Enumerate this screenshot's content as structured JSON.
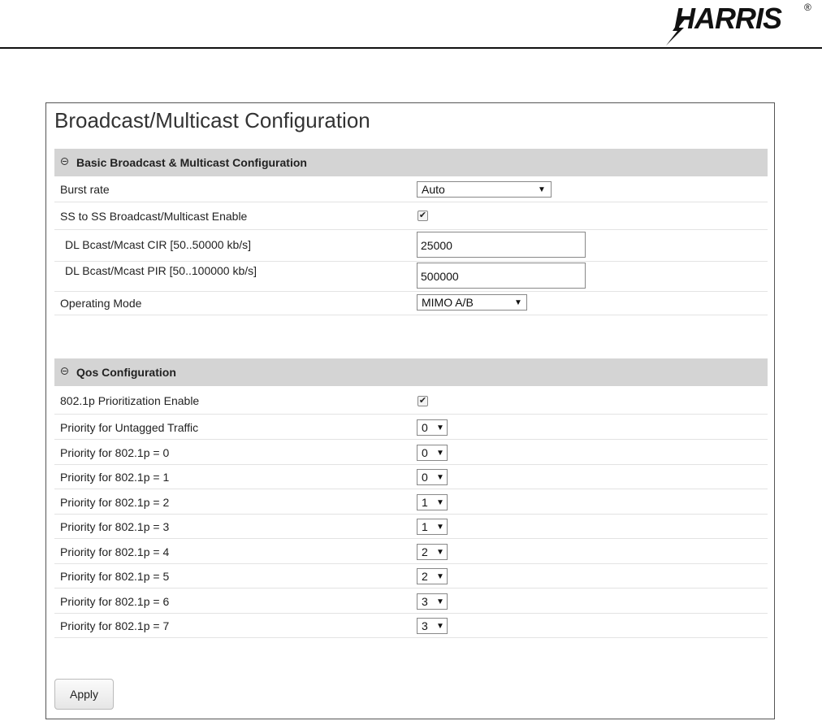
{
  "brand": {
    "name": "HARRIS",
    "mark": "®"
  },
  "page": {
    "title": "Broadcast/Multicast Configuration"
  },
  "basic": {
    "heading": "Basic Broadcast & Multicast Configuration",
    "burst_rate": {
      "label": "Burst rate",
      "value": "Auto"
    },
    "ss_enable": {
      "label": "SS to SS Broadcast/Multicast Enable",
      "checked": true
    },
    "dl_cir": {
      "label": "DL Bcast/Mcast CIR [50..50000 kb/s]",
      "value": "25000"
    },
    "dl_pir": {
      "label": "DL Bcast/Mcast PIR [50..100000 kb/s]",
      "value": "500000"
    },
    "operating_mode": {
      "label": "Operating Mode",
      "value": "MIMO A/B"
    }
  },
  "qos": {
    "heading": "Qos Configuration",
    "prio_enable": {
      "label": "802.1p Prioritization Enable",
      "checked": true
    },
    "rows": [
      {
        "label": "Priority for Untagged Traffic",
        "value": "0"
      },
      {
        "label": "Priority for 802.1p = 0",
        "value": "0"
      },
      {
        "label": "Priority for 802.1p = 1",
        "value": "0"
      },
      {
        "label": "Priority for 802.1p = 2",
        "value": "1"
      },
      {
        "label": "Priority for 802.1p = 3",
        "value": "1"
      },
      {
        "label": "Priority for 802.1p = 4",
        "value": "2"
      },
      {
        "label": "Priority for 802.1p = 5",
        "value": "2"
      },
      {
        "label": "Priority for 802.1p = 6",
        "value": "3"
      },
      {
        "label": "Priority for 802.1p = 7",
        "value": "3"
      }
    ]
  },
  "apply_label": "Apply",
  "glyphs": {
    "check": "✔",
    "arrow": "▼"
  }
}
